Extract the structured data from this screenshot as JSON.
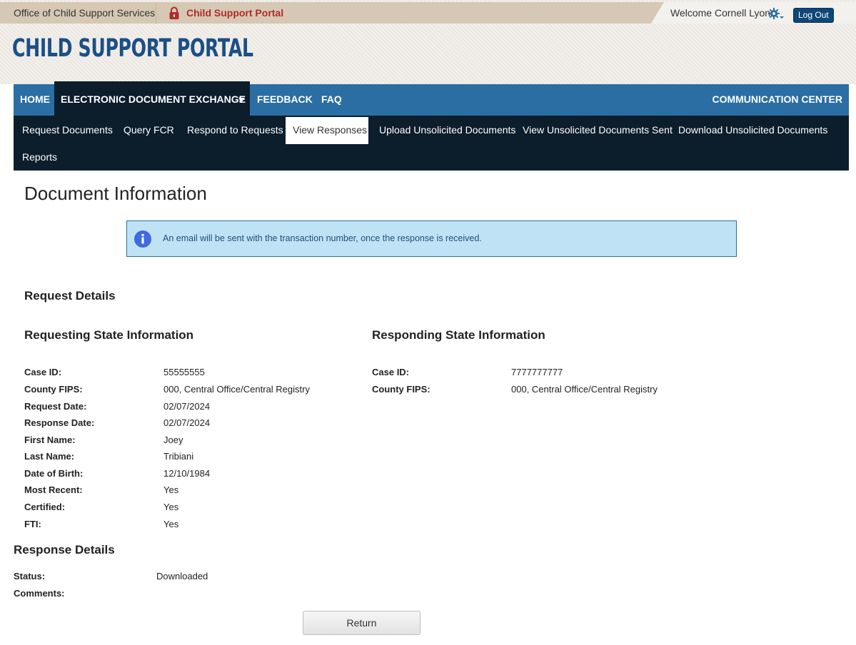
{
  "topbar": {
    "agency": "Office of Child Support Services",
    "portal_name": "Child Support Portal",
    "welcome": "Welcome Cornell Lyon",
    "logout_label": "Log Out"
  },
  "brand": {
    "title": "Child Support Portal",
    "title_color": "#1b4f86"
  },
  "main_nav": {
    "items": [
      {
        "label": "HOME",
        "active": false
      },
      {
        "label": "ELECTRONIC DOCUMENT EXCHANGE",
        "active": true,
        "has_dropdown": true
      },
      {
        "label": "FEEDBACK",
        "active": false
      },
      {
        "label": "FAQ",
        "active": false
      }
    ],
    "right_item": "COMMUNICATION CENTER",
    "bar_color": "#2b6ea3",
    "active_color": "#0c1d2c"
  },
  "sub_nav": {
    "items": [
      {
        "label": "Request Documents",
        "active": false
      },
      {
        "label": "Query FCR",
        "active": false
      },
      {
        "label": "Respond to Requests",
        "active": false
      },
      {
        "label": "View Responses",
        "active": true
      },
      {
        "label": "Upload Unsolicited Documents",
        "active": false
      },
      {
        "label": "View Unsolicited Documents Sent",
        "active": false
      },
      {
        "label": "Download Unsolicited Documents",
        "active": false
      },
      {
        "label": "Reports",
        "active": false
      }
    ]
  },
  "page": {
    "title": "Document Information",
    "alert": "An email will be sent with the transaction number, once the response is received."
  },
  "request_details": {
    "heading": "Request Details",
    "requesting": {
      "heading": "Requesting State Information",
      "fields": [
        {
          "label": "Case ID:",
          "value": "55555555"
        },
        {
          "label": "County FIPS:",
          "value": "000, Central Office/Central Registry"
        },
        {
          "label": "Request Date:",
          "value": "02/07/2024"
        },
        {
          "label": "Response Date:",
          "value": "02/07/2024"
        },
        {
          "label": "First Name:",
          "value": "Joey"
        },
        {
          "label": "Last Name:",
          "value": "Tribiani"
        },
        {
          "label": "Date of Birth:",
          "value": "12/10/1984"
        },
        {
          "label": "Most Recent:",
          "value": "Yes"
        },
        {
          "label": "Certified:",
          "value": "Yes"
        },
        {
          "label": "FTI:",
          "value": "Yes"
        }
      ]
    },
    "responding": {
      "heading": "Responding State Information",
      "fields": [
        {
          "label": "Case ID:",
          "value": "7777777777"
        },
        {
          "label": "County FIPS:",
          "value": "000, Central Office/Central Registry"
        }
      ]
    }
  },
  "response_details": {
    "heading": "Response Details",
    "fields": [
      {
        "label": "Status:",
        "value": "Downloaded"
      },
      {
        "label": "Comments:",
        "value": ""
      }
    ]
  },
  "actions": {
    "return_label": "Return"
  }
}
